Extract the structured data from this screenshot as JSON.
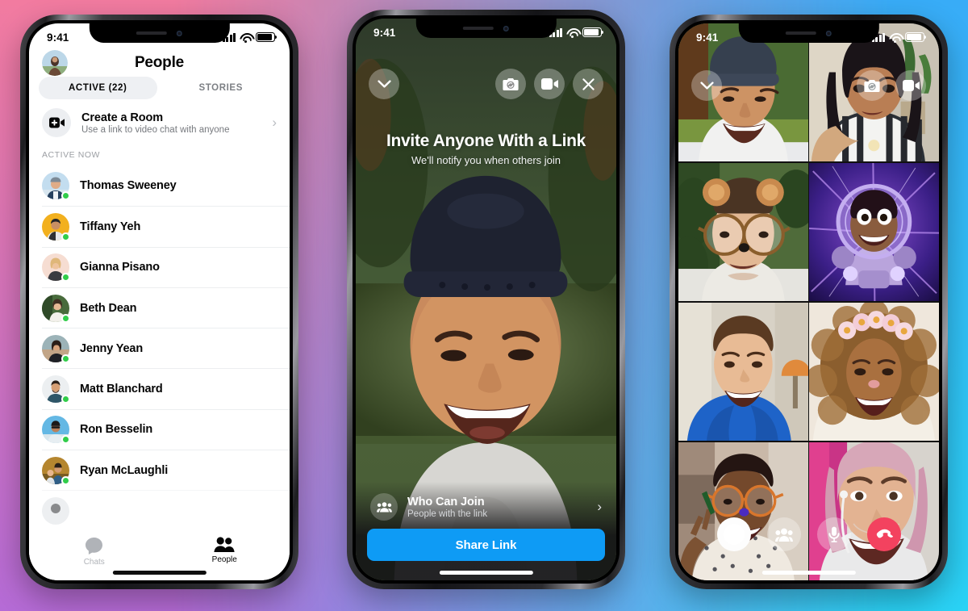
{
  "background": {
    "corner_top_left": "#f27ba0",
    "corner_top_right": "#38acf7",
    "corner_bottom_left": "#b56bd6",
    "corner_bottom_right": "#2ad2f5"
  },
  "phone_people": {
    "status_bar": {
      "time": "9:41",
      "signal_icon": "cellular-bars-icon",
      "wifi_icon": "wifi-icon",
      "battery_icon": "battery-icon"
    },
    "header": {
      "title": "People",
      "avatar_name": "profile-avatar"
    },
    "tabs": [
      {
        "label": "ACTIVE (22)",
        "active": true
      },
      {
        "label": "STORIES",
        "active": false
      }
    ],
    "create_room": {
      "title": "Create a Room",
      "subtitle": "Use a link to video chat with anyone",
      "icon": "video-plus-icon",
      "chevron": "›"
    },
    "section_label": "ACTIVE NOW",
    "contacts": [
      {
        "name": "Thomas Sweeney",
        "online": true
      },
      {
        "name": "Tiffany Yeh",
        "online": true
      },
      {
        "name": "Gianna Pisano",
        "online": true
      },
      {
        "name": "Beth Dean",
        "online": true
      },
      {
        "name": "Jenny Yean",
        "online": true
      },
      {
        "name": "Matt Blanchard",
        "online": true
      },
      {
        "name": "Ron Besselin",
        "online": true
      },
      {
        "name": "Ryan McLaughli",
        "online": true
      }
    ],
    "tabbar": [
      {
        "label": "Chats",
        "icon": "chat-bubble-icon",
        "active": false
      },
      {
        "label": "People",
        "icon": "people-icon",
        "active": true
      }
    ],
    "online_dot_color": "#31cd4a",
    "active_tab_bg": "#eef0f3"
  },
  "phone_invite": {
    "status_bar": {
      "time": "9:41",
      "signal_icon": "cellular-bars-icon",
      "wifi_icon": "wifi-icon",
      "battery_icon": "battery-icon"
    },
    "minimize_icon": "chevron-down-icon",
    "top_controls": [
      {
        "icon": "camera-flip-icon",
        "name": "switch-camera-button"
      },
      {
        "icon": "video-camera-icon",
        "name": "toggle-video-button"
      },
      {
        "icon": "close-x-icon",
        "name": "close-button"
      }
    ],
    "headline": "Invite Anyone With a Link",
    "subhead": "We'll notify you when others join",
    "who_can_join": {
      "title": "Who Can Join",
      "subtitle": "People with the link",
      "icon": "group-people-icon",
      "chevron": "›"
    },
    "share_button": {
      "label": "Share Link",
      "color": "#0e9bf5"
    }
  },
  "phone_call": {
    "status_bar": {
      "time": "9:41",
      "signal_icon": "cellular-bars-icon",
      "wifi_icon": "wifi-icon",
      "battery_icon": "battery-icon"
    },
    "minimize_icon": "chevron-down-icon",
    "top_controls": [
      {
        "icon": "camera-flip-icon",
        "name": "switch-camera-button"
      },
      {
        "icon": "video-camera-icon",
        "name": "toggle-video-button"
      }
    ],
    "participants": [
      {
        "position": "row1-left",
        "description": "man in backwards grey cap outdoors"
      },
      {
        "position": "row1-right",
        "description": "woman in striped top resting on hand"
      },
      {
        "position": "row2-left",
        "description": "man with bear-ears and big glasses filter"
      },
      {
        "position": "row2-right",
        "description": "person with purple astronaut filter"
      },
      {
        "position": "row3-left",
        "description": "man in blue hoodie indoors"
      },
      {
        "position": "row3-right",
        "description": "woman with flower-crown filter"
      },
      {
        "position": "row4-left",
        "description": "woman with glasses making peace sign"
      },
      {
        "position": "row4-right",
        "description": "woman with pink hair and earphones"
      }
    ],
    "bottom_controls": [
      {
        "icon": "effects-circle-icon",
        "name": "effects-button",
        "color": "#fdfdfd"
      },
      {
        "icon": "people-icon",
        "name": "participants-button",
        "color": "rgba(255,255,255,.3)"
      },
      {
        "icon": "microphone-icon",
        "name": "mute-button",
        "color": "rgba(255,255,255,.3)"
      },
      {
        "icon": "end-call-icon",
        "name": "end-call-button",
        "color": "#f3425f"
      }
    ]
  }
}
